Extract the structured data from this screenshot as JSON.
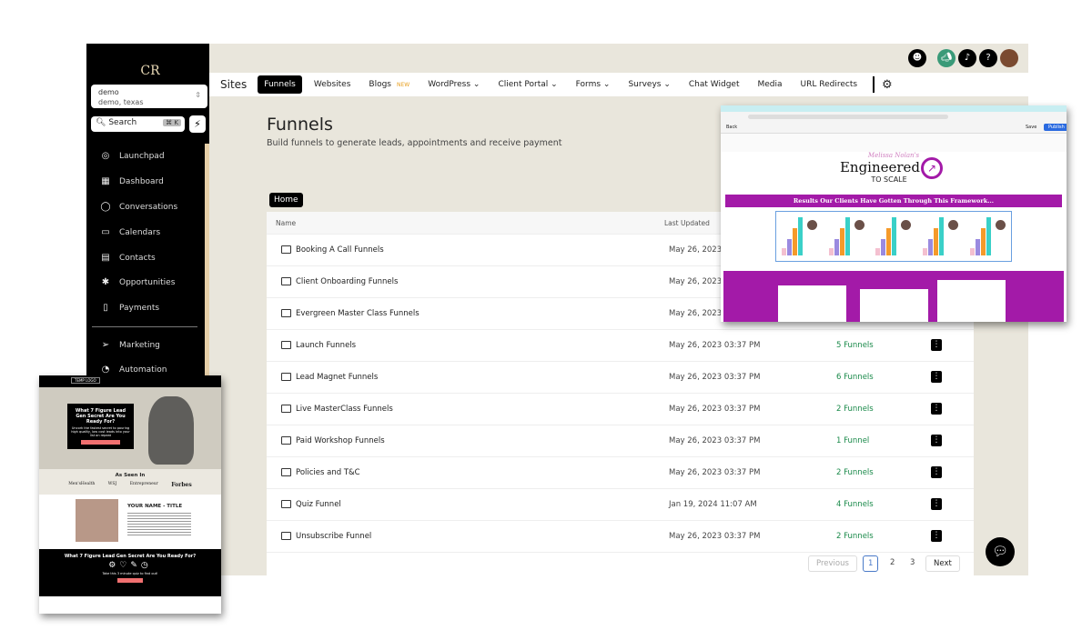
{
  "sidebar": {
    "logo": "CR",
    "location": {
      "name": "demo",
      "detail": "demo, texas"
    },
    "search": {
      "label": "Search",
      "shortcut": "⌘ K"
    },
    "items": [
      {
        "label": "Launchpad",
        "icon": "rocket-icon"
      },
      {
        "label": "Dashboard",
        "icon": "dashboard-icon"
      },
      {
        "label": "Conversations",
        "icon": "chat-icon"
      },
      {
        "label": "Calendars",
        "icon": "calendar-icon"
      },
      {
        "label": "Contacts",
        "icon": "contacts-icon"
      },
      {
        "label": "Opportunities",
        "icon": "opportunities-icon"
      },
      {
        "label": "Payments",
        "icon": "payments-icon"
      }
    ],
    "items2": [
      {
        "label": "Marketing",
        "icon": "send-icon"
      },
      {
        "label": "Automation",
        "icon": "automation-icon"
      }
    ]
  },
  "nav": {
    "section": "Sites",
    "tabs": [
      "Funnels",
      "Websites",
      "Blogs",
      "WordPress",
      "Client Portal",
      "Forms",
      "Surveys",
      "Chat Widget",
      "Media",
      "URL Redirects"
    ],
    "new_badge": "NEW",
    "help": "?"
  },
  "page": {
    "title": "Funnels",
    "subtitle": "Build funnels to generate leads, appointments and receive payment",
    "breadcrumb": "Home"
  },
  "table": {
    "headers": [
      "Name",
      "Last Updated"
    ],
    "rows": [
      {
        "name": "Booking A Call Funnels",
        "updated": "May 26, 2023",
        "count": ""
      },
      {
        "name": "Client Onboarding Funnels",
        "updated": "May 26, 2023",
        "count": ""
      },
      {
        "name": "Evergreen Master Class Funnels",
        "updated": "May 26, 2023",
        "count": ""
      },
      {
        "name": "Launch Funnels",
        "updated": "May 26, 2023 03:37 PM",
        "count": "5 Funnels"
      },
      {
        "name": "Lead Magnet Funnels",
        "updated": "May 26, 2023 03:37 PM",
        "count": "6 Funnels"
      },
      {
        "name": "Live MasterClass Funnels",
        "updated": "May 26, 2023 03:37 PM",
        "count": "2 Funnels"
      },
      {
        "name": "Paid Workshop Funnels",
        "updated": "May 26, 2023 03:37 PM",
        "count": "1 Funnel"
      },
      {
        "name": "Policies and T&C",
        "updated": "May 26, 2023 03:37 PM",
        "count": "2 Funnels"
      },
      {
        "name": "Quiz Funnel",
        "updated": "Jan 19, 2024 11:07 AM",
        "count": "4 Funnels"
      },
      {
        "name": "Unsubscribe Funnel",
        "updated": "May 26, 2023 03:37 PM",
        "count": "2 Funnels"
      }
    ]
  },
  "pagination": {
    "previous": "Previous",
    "pages": [
      "1",
      "2",
      "3"
    ],
    "current": "1",
    "next": "Next"
  },
  "preview1": {
    "brand_script": "Melissa Nolan's",
    "brand": "Engineered",
    "brand_sub": "TO SCALE",
    "banner": "Results Our Clients Have Gotten Through This Framework...",
    "publish": "Publish",
    "save": "Save",
    "back": "Back"
  },
  "preview2": {
    "logo": "TEMP LOGO",
    "hero_title": "What 7 Figure Lead Gen Secret Are You Ready For?",
    "hero_sub": "Uncork the fastest secret to pouring high quality, low cost leads into your list on repeat",
    "as_seen": "As Seen In",
    "press": [
      "Men'sHealth",
      "WSJ",
      "Entrepreneur",
      "Forbes"
    ],
    "name_title": "YOUR NAME - TITLE",
    "cta_title": "What 7 Figure Lead Gen Secret Are You Ready For?",
    "cta_sub": "Take this 3 minute quiz to find out!"
  },
  "colors": {
    "accent": "#000000",
    "success": "#1a8a4a",
    "purple": "#a31aa8",
    "bg": "#e9e6dc"
  }
}
